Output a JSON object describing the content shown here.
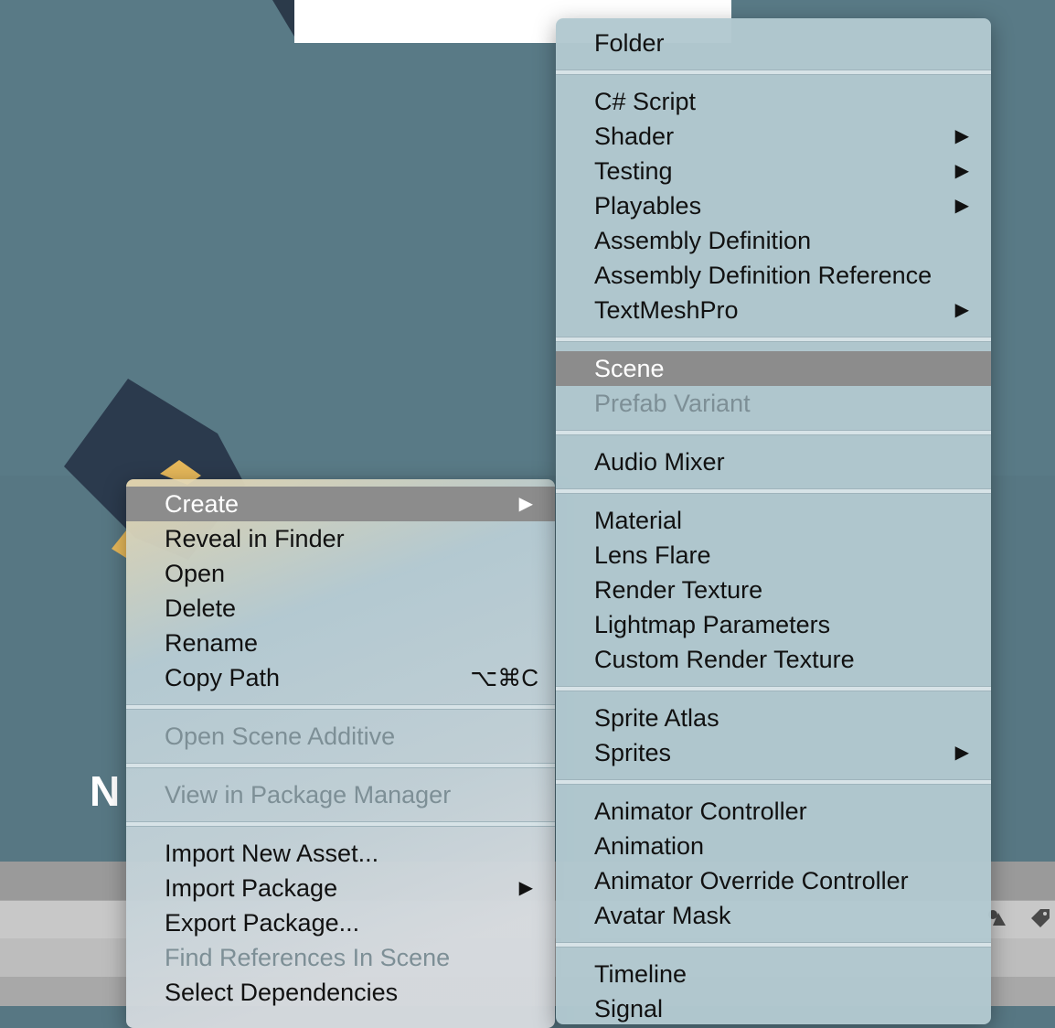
{
  "background": {
    "label": "N"
  },
  "context_menu": {
    "items": [
      {
        "label": "Create",
        "arrow": "▶",
        "highlighted": true
      },
      {
        "label": "Reveal in Finder"
      },
      {
        "label": "Open"
      },
      {
        "label": "Delete"
      },
      {
        "label": "Rename"
      },
      {
        "label": "Copy Path",
        "shortcut": "⌥⌘C"
      },
      {
        "separator": true
      },
      {
        "label": "Open Scene Additive",
        "disabled": true
      },
      {
        "separator": true
      },
      {
        "label": "View in Package Manager",
        "disabled": true
      },
      {
        "separator": true
      },
      {
        "label": "Import New Asset..."
      },
      {
        "label": "Import Package",
        "arrow": "▶"
      },
      {
        "label": "Export Package..."
      },
      {
        "label": "Find References In Scene",
        "disabled": true
      },
      {
        "label": "Select Dependencies"
      }
    ]
  },
  "create_submenu": {
    "items": [
      {
        "label": "Folder"
      },
      {
        "separator": true
      },
      {
        "label": "C# Script"
      },
      {
        "label": "Shader",
        "arrow": "▶"
      },
      {
        "label": "Testing",
        "arrow": "▶"
      },
      {
        "label": "Playables",
        "arrow": "▶"
      },
      {
        "label": "Assembly Definition"
      },
      {
        "label": "Assembly Definition Reference"
      },
      {
        "label": "TextMeshPro",
        "arrow": "▶"
      },
      {
        "separator": true
      },
      {
        "label": "Scene",
        "highlighted": true
      },
      {
        "label": "Prefab Variant",
        "disabled": true
      },
      {
        "separator": true
      },
      {
        "label": "Audio Mixer"
      },
      {
        "separator": true
      },
      {
        "label": "Material"
      },
      {
        "label": "Lens Flare"
      },
      {
        "label": "Render Texture"
      },
      {
        "label": "Lightmap Parameters"
      },
      {
        "label": "Custom Render Texture"
      },
      {
        "separator": true
      },
      {
        "label": "Sprite Atlas"
      },
      {
        "label": "Sprites",
        "arrow": "▶"
      },
      {
        "separator": true
      },
      {
        "label": "Animator Controller"
      },
      {
        "label": "Animation"
      },
      {
        "label": "Animator Override Controller"
      },
      {
        "label": "Avatar Mask"
      },
      {
        "separator": true
      },
      {
        "label": "Timeline"
      },
      {
        "label": "Signal"
      }
    ]
  },
  "toolbar_icons": [
    "shapes-icon",
    "tag-icon"
  ],
  "colors": {
    "scene_bg": "#577783",
    "menu_bg": "#b7ccd4",
    "highlight": "#8c8c8c",
    "disabled_text": "#7d8f96"
  }
}
